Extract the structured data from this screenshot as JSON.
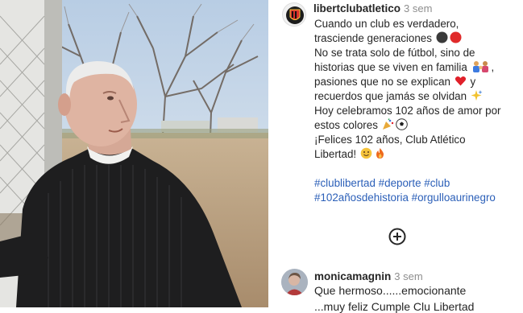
{
  "post": {
    "author": "libertclubatletico",
    "time": "3 sem",
    "caption_lines": [
      "Cuando un club es verdadero,",
      "trasciende generaciones",
      "No se trata solo de fútbol, sino de",
      "historias que se viven en familia",
      "pasiones que no se explican",
      "recuerdos que jamás se olvidan",
      "Hoy celebramos 102 años de amor por",
      "estos colores",
      "¡Felices 102 años, Club Atlético",
      "Libertad!"
    ],
    "caption_suffixes": {
      "line4": ",",
      "line5": "y"
    },
    "hashtags": [
      "#clublibertad",
      "#deporte",
      "#club",
      "#102añosdehistoria",
      "#orgulloaurinegro"
    ],
    "emoji_icons": [
      "black-circle-icon",
      "red-circle-icon",
      "family-icon",
      "red-heart-icon",
      "sparkles-icon",
      "party-popper-icon",
      "soccer-ball-icon",
      "smiling-face-icon",
      "fire-icon"
    ]
  },
  "more_comments_icon": "plus-circle-icon",
  "comment": {
    "author": "monicamagnin",
    "time": "3 sem",
    "text": "Que hermoso......emocionante",
    "text_cont": "...muy feliz Cumple Clu Libertad"
  },
  "colors": {
    "hashtag": "#2b5fb8",
    "text": "#262626",
    "muted": "#8e8e8e",
    "club_red": "#d9302c"
  }
}
